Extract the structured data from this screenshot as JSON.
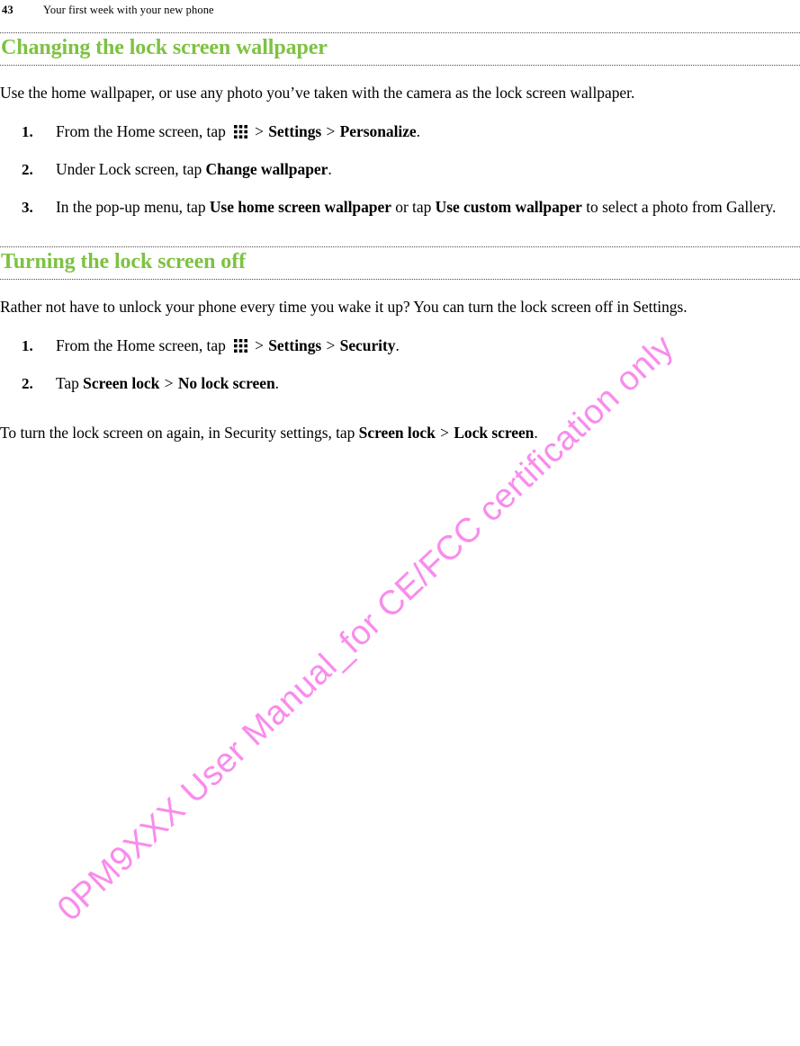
{
  "document": {
    "page_number": "43",
    "chapter": "Your first week with your new phone"
  },
  "watermark": {
    "text": "0PM9XXX User Manual_for CE/FCC certification only",
    "color": "#f98cec"
  },
  "colors": {
    "heading_green": "#7dc242",
    "body_black": "#000000",
    "rule_gray": "#4a4a4a"
  },
  "sections": [
    {
      "heading": "Changing the lock screen wallpaper",
      "intro": "Use the home wallpaper, or use any photo you’ve taken with the camera as the lock screen wallpaper.",
      "steps": [
        {
          "number": "1.",
          "parts": [
            {
              "type": "text",
              "value": "From the Home screen, tap "
            },
            {
              "type": "icon",
              "value": "app-drawer-grid-icon"
            },
            {
              "type": "gt",
              "value": ">"
            },
            {
              "type": "bold",
              "value": "Settings"
            },
            {
              "type": "gt",
              "value": ">"
            },
            {
              "type": "bold",
              "value": "Personalize"
            },
            {
              "type": "text",
              "value": "."
            }
          ]
        },
        {
          "number": "2.",
          "parts": [
            {
              "type": "text",
              "value": "Under Lock screen, tap "
            },
            {
              "type": "bold",
              "value": "Change wallpaper"
            },
            {
              "type": "text",
              "value": "."
            }
          ]
        },
        {
          "number": "3.",
          "parts": [
            {
              "type": "text",
              "value": "In the pop-up menu, tap "
            },
            {
              "type": "bold",
              "value": "Use home screen wallpaper"
            },
            {
              "type": "text",
              "value": " or tap "
            },
            {
              "type": "bold",
              "value": "Use custom wallpaper"
            },
            {
              "type": "text",
              "value": " to select a photo from Gallery."
            }
          ]
        }
      ]
    },
    {
      "heading": "Turning the lock screen off",
      "intro": "Rather not have to unlock your phone every time you wake it up? You can turn the lock screen off in Settings.",
      "steps": [
        {
          "number": "1.",
          "parts": [
            {
              "type": "text",
              "value": "From the Home screen, tap "
            },
            {
              "type": "icon",
              "value": "app-drawer-grid-icon"
            },
            {
              "type": "gt",
              "value": ">"
            },
            {
              "type": "bold",
              "value": "Settings"
            },
            {
              "type": "gt",
              "value": ">"
            },
            {
              "type": "bold",
              "value": "Security"
            },
            {
              "type": "text",
              "value": "."
            }
          ]
        },
        {
          "number": "2.",
          "parts": [
            {
              "type": "text",
              "value": "Tap "
            },
            {
              "type": "bold",
              "value": "Screen lock"
            },
            {
              "type": "gt",
              "value": ">"
            },
            {
              "type": "bold",
              "value": "No lock screen"
            },
            {
              "type": "text",
              "value": "."
            }
          ]
        }
      ],
      "outro": [
        {
          "type": "text",
          "value": "To turn the lock screen on again, in Security settings, tap "
        },
        {
          "type": "bold",
          "value": "Screen lock"
        },
        {
          "type": "gt",
          "value": ">"
        },
        {
          "type": "bold",
          "value": "Lock screen"
        },
        {
          "type": "text",
          "value": "."
        }
      ]
    }
  ]
}
